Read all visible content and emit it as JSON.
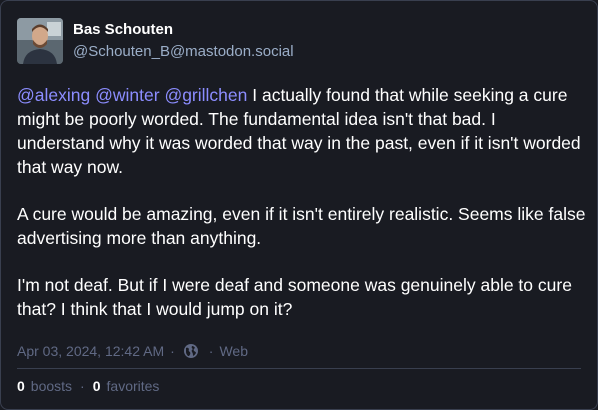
{
  "author": {
    "display_name": "Bas Schouten",
    "handle": "@Schouten_B@mastodon.social"
  },
  "post": {
    "mentions": [
      "@alexing",
      "@winter",
      "@grillchen"
    ],
    "paragraph1_text": " I actually found that while seeking a cure might be poorly worded. The fundamental idea isn't that bad. I understand why it was worded that way in the past, even if it isn't worded that way now.",
    "paragraph2": "A cure would be amazing, even if it isn't entirely realistic. Seems like false advertising more than anything.",
    "paragraph3": "I'm not deaf. But if I were deaf and someone was genuinely able to cure that? I think that I would jump on it?"
  },
  "meta": {
    "timestamp": "Apr 03, 2024, 12:42 AM",
    "separator": "·",
    "visibility_icon": "globe-icon",
    "application": "Web"
  },
  "stats": {
    "boosts_count": "0",
    "boosts_label": "boosts",
    "favorites_count": "0",
    "favorites_label": "favorites",
    "separator": "·"
  },
  "colors": {
    "background": "#191b22",
    "mention": "#8c8dff",
    "muted": "#606984",
    "handle": "#9baec8"
  }
}
